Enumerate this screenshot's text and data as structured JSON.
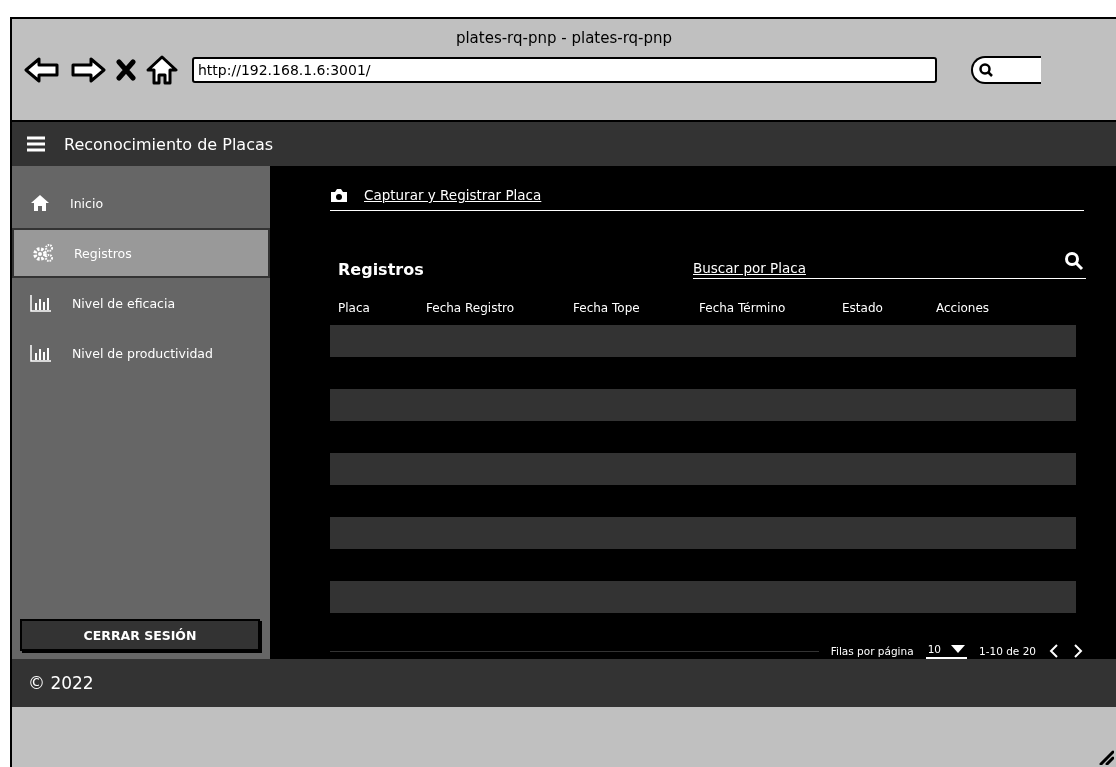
{
  "browser": {
    "title": "plates-rq-pnp - plates-rq-pnp",
    "url": "http://192.168.1.6:3001/"
  },
  "app_bar": {
    "title": "Reconocimiento de Placas"
  },
  "sidebar": {
    "items": [
      {
        "label": "Inicio",
        "selected": false
      },
      {
        "label": "Registros",
        "selected": true
      },
      {
        "label": "Nivel de eficacia",
        "selected": false
      },
      {
        "label": "Nivel de productividad",
        "selected": false
      }
    ],
    "logout_button": "CERRAR SESIÓN"
  },
  "main": {
    "capture_link": "Capturar y Registrar Placa",
    "heading": "Registros",
    "search": {
      "placeholder": "Buscar por Placa"
    },
    "table": {
      "columns": [
        "Placa",
        "Fecha Registro",
        "Fecha Tope",
        "Fecha Término",
        "Estado",
        "Acciones"
      ]
    },
    "pagination": {
      "rows_label": "Filas por página",
      "rows_per_page": "10",
      "range": "1-10 de 20"
    }
  },
  "footer": {
    "text": "© 2022"
  }
}
